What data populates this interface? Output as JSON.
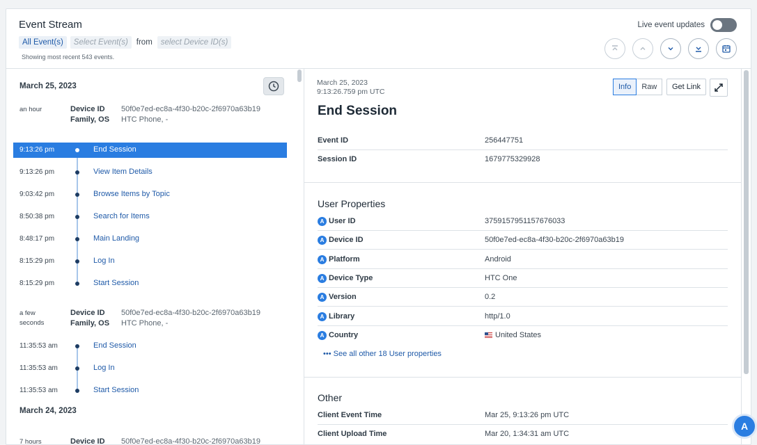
{
  "header": {
    "title": "Event Stream",
    "all_events": "All Event(s)",
    "select_events_placeholder": "Select Event(s)",
    "from": "from",
    "device_placeholder": "select Device ID(s)",
    "showing": "Showing most recent 543 events.",
    "live_label": "Live event updates",
    "live_on": false
  },
  "nav_icons": [
    "jump-to-top-icon",
    "previous-icon",
    "next-icon",
    "jump-to-bottom-icon",
    "calendar-icon"
  ],
  "left": {
    "date1": "March 25, 2023",
    "session1": {
      "ago": "an hour",
      "device_label": "Device ID",
      "device_value": "50f0e7ed-ec8a-4f30-b20c-2f6970a63b19",
      "family_label": "Family, OS",
      "family_value": "HTC Phone, -"
    },
    "events1": [
      {
        "time": "9:13:26 pm",
        "name": "End Session"
      },
      {
        "time": "9:13:26 pm",
        "name": "View Item Details"
      },
      {
        "time": "9:03:42 pm",
        "name": "Browse Items by Topic"
      },
      {
        "time": "8:50:38 pm",
        "name": "Search for Items"
      },
      {
        "time": "8:48:17 pm",
        "name": "Main Landing"
      },
      {
        "time": "8:15:29 pm",
        "name": "Log In"
      },
      {
        "time": "8:15:29 pm",
        "name": "Start Session"
      }
    ],
    "session2": {
      "ago_line1": "a few",
      "ago_line2": "seconds",
      "device_label": "Device ID",
      "device_value": "50f0e7ed-ec8a-4f30-b20c-2f6970a63b19",
      "family_label": "Family, OS",
      "family_value": "HTC Phone, -"
    },
    "events2": [
      {
        "time": "11:35:53 am",
        "name": "End Session"
      },
      {
        "time": "11:35:53 am",
        "name": "Log In"
      },
      {
        "time": "11:35:53 am",
        "name": "Start Session"
      }
    ],
    "date2": "March 24, 2023",
    "session3": {
      "ago": "7 hours",
      "device_label": "Device ID",
      "device_value": "50f0e7ed-ec8a-4f30-b20c-2f6970a63b19"
    }
  },
  "detail": {
    "date": "March 25, 2023",
    "time": "9:13:26.759 pm UTC",
    "info_label": "Info",
    "raw_label": "Raw",
    "get_link_label": "Get Link",
    "title": "End Session",
    "event_id_label": "Event ID",
    "event_id": "256447751",
    "session_id_label": "Session ID",
    "session_id": "1679775329928",
    "user_props_title": "User Properties",
    "user_props": [
      {
        "label": "User ID",
        "value": "3759157951157676033"
      },
      {
        "label": "Device ID",
        "value": "50f0e7ed-ec8a-4f30-b20c-2f6970a63b19"
      },
      {
        "label": "Platform",
        "value": "Android"
      },
      {
        "label": "Device Type",
        "value": "HTC One"
      },
      {
        "label": "Version",
        "value": "0.2"
      },
      {
        "label": "Library",
        "value": "http/1.0"
      },
      {
        "label": "Country",
        "value": "United States"
      }
    ],
    "see_all": "See all other 18 User properties",
    "other_title": "Other",
    "other": [
      {
        "label": "Client Event Time",
        "value": "Mar 25, 9:13:26 pm UTC"
      },
      {
        "label": "Client Upload Time",
        "value": "Mar 20, 1:34:31 am UTC"
      }
    ]
  },
  "colors": {
    "accent": "#2a7de1",
    "link": "#1f5aa8"
  }
}
